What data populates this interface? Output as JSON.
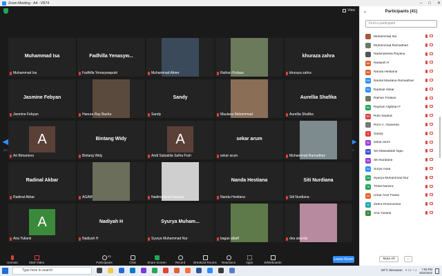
{
  "window": {
    "title": "Zoom Meeting - A4 - VR74"
  },
  "topbar": {
    "view_label": "View"
  },
  "pagination": {
    "left": "2/2",
    "right": "2/2"
  },
  "tiles": [
    {
      "name": "Muhammad Isa",
      "label": "Muhammad Isa",
      "kind": "name"
    },
    {
      "name": "Fadhilla  Yenasyw...",
      "label": "Fadhilla Yenasywaputri",
      "kind": "name"
    },
    {
      "name": "",
      "label": "Muhammad Almer",
      "kind": "video",
      "color": "#3a4a5a"
    },
    {
      "name": "",
      "label": "Raihan Firdaus",
      "kind": "video",
      "color": "#6b7a5a"
    },
    {
      "name": "khuraza zahra",
      "label": "khuraza zahra",
      "kind": "name"
    },
    {
      "name": "Jasmine Febyan",
      "label": "Jasmine Febyan",
      "kind": "name"
    },
    {
      "name": "",
      "label": "Hanura Ray Basha",
      "kind": "video",
      "color": "#5a4a3e"
    },
    {
      "name": "Sandy",
      "label": "Sandy",
      "kind": "name"
    },
    {
      "name": "",
      "label": "Maulana Muhammad",
      "kind": "video",
      "color": "#8a6e56"
    },
    {
      "name": "Aurellia Shafika",
      "label": "Aurellia Shafika",
      "kind": "name"
    },
    {
      "name": "",
      "label": "Ari Bimantoro",
      "kind": "avatar",
      "initial": "A",
      "color": "#5b4038"
    },
    {
      "name": "Bintang Widy",
      "label": "Bintang Widy",
      "kind": "name"
    },
    {
      "name": "",
      "label": "Andi Salsabila Safira Putri",
      "kind": "avatar",
      "initial": "A",
      "color": "#5b4038"
    },
    {
      "name": "sekar arum",
      "label": "sekar arum",
      "kind": "name"
    },
    {
      "name": "",
      "label": "Muhammad Ramadhan",
      "kind": "video",
      "color": "#7d8a8e"
    },
    {
      "name": "Radinal Akbar",
      "label": "Radinal Akbar",
      "kind": "name"
    },
    {
      "name": "",
      "label": "AGAM",
      "kind": "video",
      "color": "#6b6e5a"
    },
    {
      "name": "",
      "label": "Nadimanissa Rayana",
      "kind": "video",
      "color": "#cfcfcf"
    },
    {
      "name": "Nanda Hestiana",
      "label": "Nanda Hestiana",
      "kind": "name"
    },
    {
      "name": "Siti Nurdiana",
      "label": "Siti Nurdiana",
      "kind": "name"
    },
    {
      "name": "",
      "label": "Ana Yulianti",
      "kind": "avatar",
      "initial": "A",
      "color": "#3b8a3b"
    },
    {
      "name": "Nadiyah H",
      "label": "Nadiyah H",
      "kind": "name"
    },
    {
      "name": "Syurya  Muham...",
      "label": "Syurya Muhammad Nur",
      "kind": "name"
    },
    {
      "name": "",
      "label": "bagas alkaff",
      "kind": "video",
      "color": "#5e7a4a"
    },
    {
      "name": "",
      "label": "dea ananda",
      "kind": "video",
      "color": "#b88aa0"
    }
  ],
  "toolbar": {
    "unmute": "Unmute",
    "start_video": "Start Video",
    "participants": "Participants",
    "participants_count": "41",
    "chat": "Chat",
    "share_screen": "Share Screen",
    "record": "Record",
    "breakout": "Breakout Rooms",
    "reactions": "Reactions",
    "apps": "Apps",
    "whiteboards": "Whiteboards",
    "leave": "Leave Room"
  },
  "panel": {
    "title": "Participants (41)",
    "search_placeholder": "Find a participant",
    "mute_all": "Mute All",
    "more": "...",
    "participants": [
      {
        "initials": "",
        "name": "Muhammad Isa",
        "color": "#a35a3a"
      },
      {
        "initials": "",
        "name": "Muhammad Ramadhan",
        "color": "#6a7a6a"
      },
      {
        "initials": "",
        "name": "Nadimanissa Rayana",
        "color": "#555555"
      },
      {
        "initials": "NH",
        "name": "Nadiyah H",
        "color": "#e0622a"
      },
      {
        "initials": "NH",
        "name": "Nanda Hestiana",
        "color": "#e0622a"
      },
      {
        "initials": "NM",
        "name": "Naufal Maulana Ramadhan",
        "color": "#2d8cff"
      },
      {
        "initials": "RA",
        "name": "Radinal Akbar",
        "color": "#2d8cff"
      },
      {
        "initials": "",
        "name": "Raihan Firdaus",
        "color": "#6b7a5a"
      },
      {
        "initials": "RA",
        "name": "Rayhan Alghifari F",
        "color": "#23a559"
      },
      {
        "initials": "RS",
        "name": "Robi Septian",
        "color": "#e0413a"
      },
      {
        "initials": "",
        "name": "Roro A. Ganeesa",
        "color": "#777777"
      },
      {
        "initials": "S",
        "name": "Sandy",
        "color": "#e0413a"
      },
      {
        "initials": "SA",
        "name": "sekar arum",
        "color": "#9b3bd6"
      },
      {
        "initials": "SM",
        "name": "Siti Mawaddah Ngiu",
        "color": "#3b4fd6"
      },
      {
        "initials": "SN",
        "name": "Siti Nurdiana",
        "color": "#9b3bd6"
      },
      {
        "initials": "SA",
        "name": "Surya Aulia",
        "color": "#2d8cff"
      },
      {
        "initials": "SM",
        "name": "Syurya Muhammad Nur",
        "color": "#23a559"
      },
      {
        "initials": "TN",
        "name": "Thifal Namira",
        "color": "#23a559"
      },
      {
        "initials": "UA",
        "name": "Umar Amir Faisal",
        "color": "#e0622a"
      },
      {
        "initials": "ZK",
        "name": "Zahra Khoirunnisa",
        "color": "#23a5a5"
      },
      {
        "initials": "A",
        "name": "Ana Yulianti",
        "color": "#3b8a3b"
      }
    ]
  },
  "taskbar": {
    "search_placeholder": "Type here to search",
    "weather": "29°C  Berawan",
    "time": "7:06 PM",
    "date": "9/22/2022"
  }
}
